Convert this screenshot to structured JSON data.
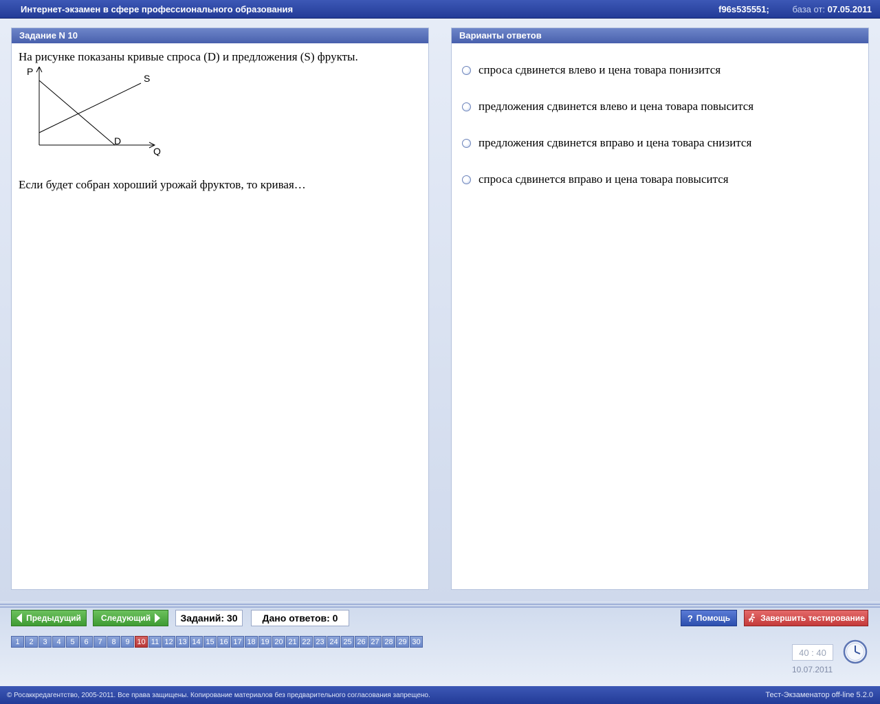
{
  "header": {
    "title": "Интернет-экзамен в сфере профессионального образования",
    "session_id": "f96s535551;",
    "db_label": "база от:",
    "db_date": "07.05.2011"
  },
  "task": {
    "heading": "Задание N 10",
    "text1": "На рисунке показаны кривые спроса (D) и предложения (S) фрукты.",
    "text2": "Если будет собран хороший урожай фруктов, то кривая…",
    "graph": {
      "axis_p": "P",
      "axis_q": "Q",
      "curve_s": "S",
      "curve_d": "D"
    }
  },
  "answers": {
    "heading": "Варианты ответов",
    "options": [
      "спроса сдвинется влево и цена товара понизится",
      "предложения сдвинется влево и цена товара повысится",
      "предложения сдвинется вправо и цена товара снизится",
      "спроса сдвинется вправо и цена товара повысится"
    ]
  },
  "toolbar": {
    "prev_label": "Предыдущий",
    "next_label": "Следующий",
    "tasks_count": "Заданий: 30",
    "answers_count": "Дано ответов: 0",
    "help_label": "Помощь",
    "finish_label": "Завершить тестирование"
  },
  "nav": {
    "numbers": [
      "1",
      "2",
      "3",
      "4",
      "5",
      "6",
      "7",
      "8",
      "9",
      "10",
      "11",
      "12",
      "13",
      "14",
      "15",
      "16",
      "17",
      "18",
      "19",
      "20",
      "21",
      "22",
      "23",
      "24",
      "25",
      "26",
      "27",
      "28",
      "29",
      "30"
    ],
    "current": "10"
  },
  "status": {
    "timer": "40 : 40",
    "date": "10.07.2011"
  },
  "footer": {
    "copyright": "© Росаккредагентство, 2005-2011. Все права защищены. Копирование материалов без предварительного согласования запрещено.",
    "version": "Тест-Экзаменатор off-line 5.2.0"
  },
  "icons": {
    "help": "question-mark-icon",
    "finish": "running-man-icon",
    "clock": "clock-icon"
  }
}
